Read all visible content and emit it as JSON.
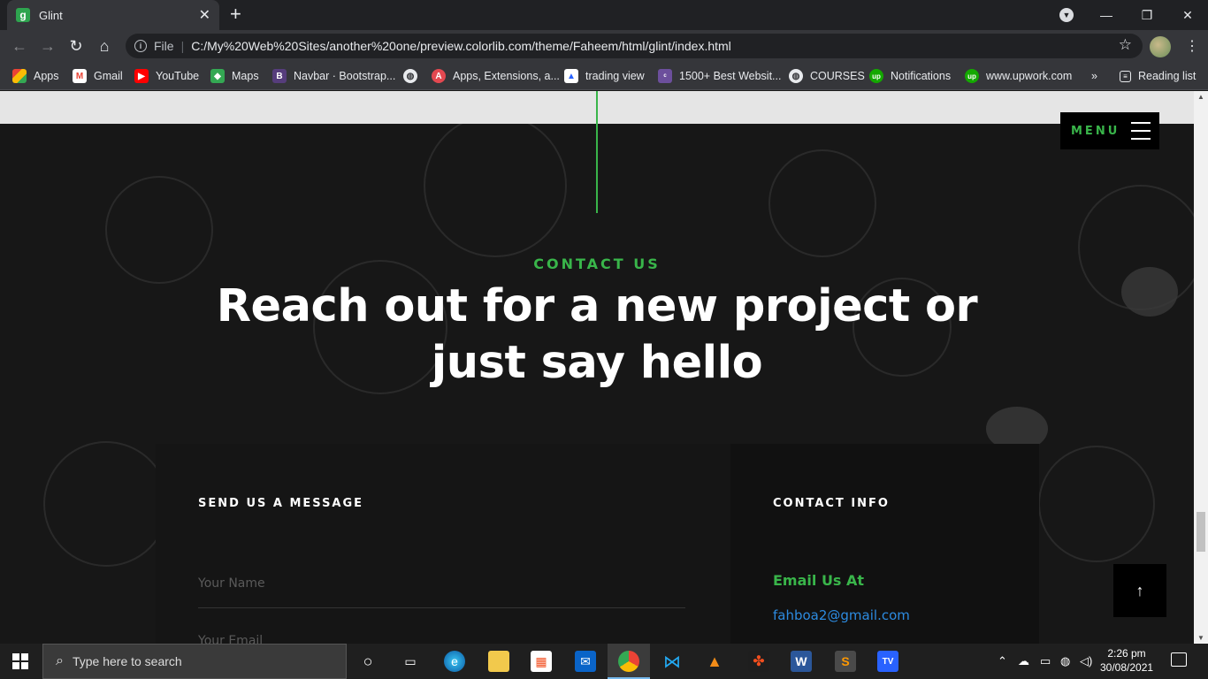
{
  "browser": {
    "tab_title": "Glint",
    "tab_favicon_letter": "g",
    "url_scheme": "File",
    "url": "C:/My%20Web%20Sites/another%20one/preview.colorlib.com/theme/Faheem/html/glint/index.html",
    "bookmarks": [
      {
        "label": "Apps",
        "icon": "apps-grid-icon"
      },
      {
        "label": "Gmail",
        "icon": "gmail-icon"
      },
      {
        "label": "YouTube",
        "icon": "youtube-icon"
      },
      {
        "label": "Maps",
        "icon": "maps-icon"
      },
      {
        "label": "Navbar · Bootstrap...",
        "icon": "bootstrap-icon"
      },
      {
        "label": "",
        "icon": "globe-icon"
      },
      {
        "label": "Apps, Extensions, a...",
        "icon": "adobe-icon"
      },
      {
        "label": "trading view",
        "icon": "tradingview-icon"
      },
      {
        "label": "1500+ Best Websit...",
        "icon": "colorlib-icon"
      },
      {
        "label": "COURSES",
        "icon": "globe-icon"
      },
      {
        "label": "Notifications",
        "icon": "upwork-icon"
      },
      {
        "label": "www.upwork.com",
        "icon": "upwork-icon"
      }
    ],
    "more_bookmarks": "»",
    "reading_list": "Reading list"
  },
  "site": {
    "menu_label": "MENU",
    "contact_kicker": "CONTACT US",
    "contact_title": "Reach out for a new project or just say hello",
    "form": {
      "heading": "SEND US A MESSAGE",
      "name_placeholder": "Your Name",
      "email_placeholder": "Your Email"
    },
    "info": {
      "heading": "CONTACT INFO",
      "email_label": "Email Us At",
      "email_value": "fahboa2@gmail.com"
    },
    "accent_color": "#39b54a",
    "link_color": "#2d8be0"
  },
  "taskbar": {
    "search_placeholder": "Type here to search",
    "time": "2:26 pm",
    "date": "30/08/2021"
  }
}
